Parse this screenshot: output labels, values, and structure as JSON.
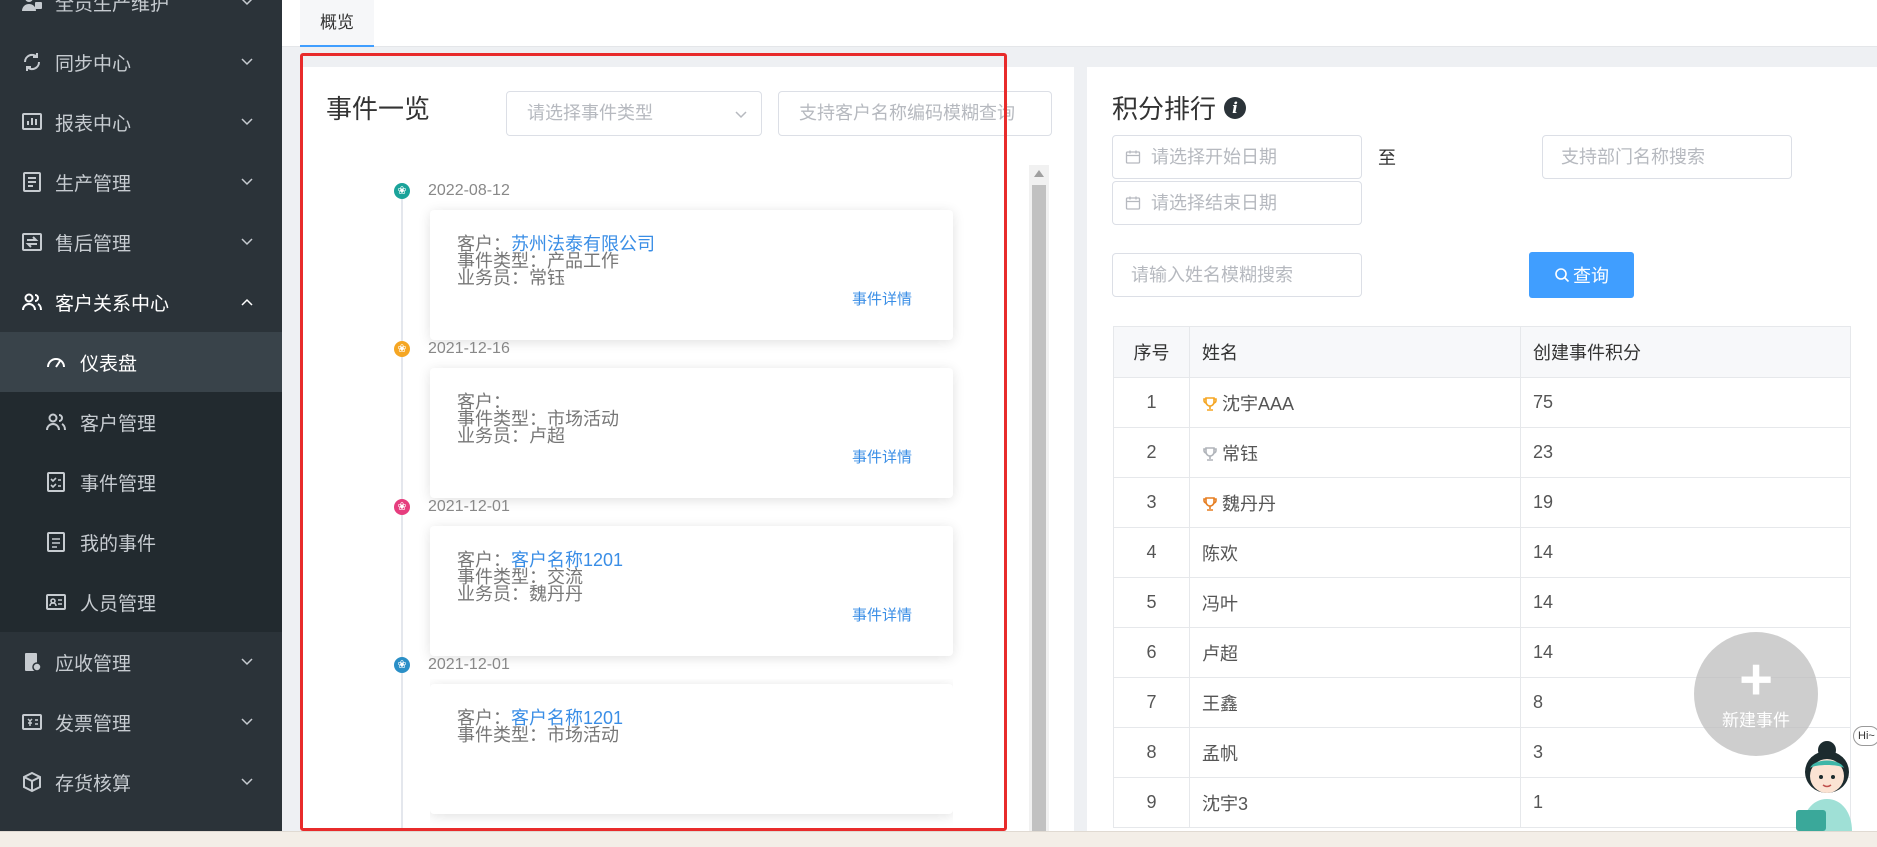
{
  "sidebar": {
    "items": [
      {
        "label": "全员生产维护",
        "icon": "tools-icon"
      },
      {
        "label": "同步中心",
        "icon": "sync-icon"
      },
      {
        "label": "报表中心",
        "icon": "chart-icon"
      },
      {
        "label": "生产管理",
        "icon": "production-icon"
      },
      {
        "label": "售后管理",
        "icon": "service-icon"
      },
      {
        "label": "客户关系中心",
        "icon": "users-icon"
      },
      {
        "label": "应收管理",
        "icon": "receivable-icon"
      },
      {
        "label": "发票管理",
        "icon": "invoice-icon"
      },
      {
        "label": "存货核算",
        "icon": "inventory-icon"
      }
    ],
    "subitems": [
      {
        "label": "仪表盘",
        "icon": "dashboard-icon"
      },
      {
        "label": "客户管理",
        "icon": "customer-icon"
      },
      {
        "label": "事件管理",
        "icon": "checklist-icon"
      },
      {
        "label": "我的事件",
        "icon": "my-events-icon"
      },
      {
        "label": "人员管理",
        "icon": "id-card-icon"
      }
    ]
  },
  "tabs": {
    "overview": "概览"
  },
  "events": {
    "title": "事件一览",
    "type_placeholder": "请选择事件类型",
    "search_placeholder": "支持客户名称编码模糊查询",
    "customer_label": "客户：",
    "type_label": "事件类型：",
    "salesman_label": "业务员：",
    "detail_link": "事件详情",
    "items": [
      {
        "date": "2022-08-12",
        "customer": "苏州法泰有限公司",
        "type": "产品工作",
        "salesman": "常钰",
        "dot_color": "#1aa39a"
      },
      {
        "date": "2021-12-16",
        "customer": "",
        "type": "市场活动",
        "salesman": "卢超",
        "dot_color": "#f5a623"
      },
      {
        "date": "2021-12-01",
        "customer": "客户名称1201",
        "type": "交流",
        "salesman": "魏丹丹",
        "dot_color": "#e63d7e"
      },
      {
        "date": "2021-12-01",
        "customer": "客户名称1201",
        "type": "市场活动",
        "salesman": "",
        "dot_color": "#2a8fc7"
      }
    ]
  },
  "ranking": {
    "title": "积分排行",
    "start_placeholder": "请选择开始日期",
    "to_label": "至",
    "end_placeholder": "请选择结束日期",
    "dept_placeholder": "支持部门名称搜索",
    "name_placeholder": "请输入姓名模糊搜索",
    "query_label": "查询",
    "columns": [
      "序号",
      "姓名",
      "创建事件积分"
    ],
    "rows": [
      {
        "no": "1",
        "name": "沈宇AAA",
        "score": "75",
        "trophy": "gold"
      },
      {
        "no": "2",
        "name": "常钰",
        "score": "23",
        "trophy": "silver"
      },
      {
        "no": "3",
        "name": "魏丹丹",
        "score": "19",
        "trophy": "bronze"
      },
      {
        "no": "4",
        "name": "陈欢",
        "score": "14",
        "trophy": ""
      },
      {
        "no": "5",
        "name": "冯叶",
        "score": "14",
        "trophy": ""
      },
      {
        "no": "6",
        "name": "卢超",
        "score": "14",
        "trophy": ""
      },
      {
        "no": "7",
        "name": "王鑫",
        "score": "8",
        "trophy": ""
      },
      {
        "no": "8",
        "name": "孟帆",
        "score": "3",
        "trophy": ""
      },
      {
        "no": "9",
        "name": "沈宇3",
        "score": "1",
        "trophy": ""
      }
    ]
  },
  "fab": {
    "label": "新建事件"
  },
  "assistant": {
    "badge": "Hi~"
  },
  "colors": {
    "accent": "#409eff",
    "sidebar_bg": "#2b3339",
    "highlight_frame": "#e82b2b",
    "gold": "#f5a623",
    "silver": "#b0b4ba",
    "bronze": "#e67e22"
  }
}
